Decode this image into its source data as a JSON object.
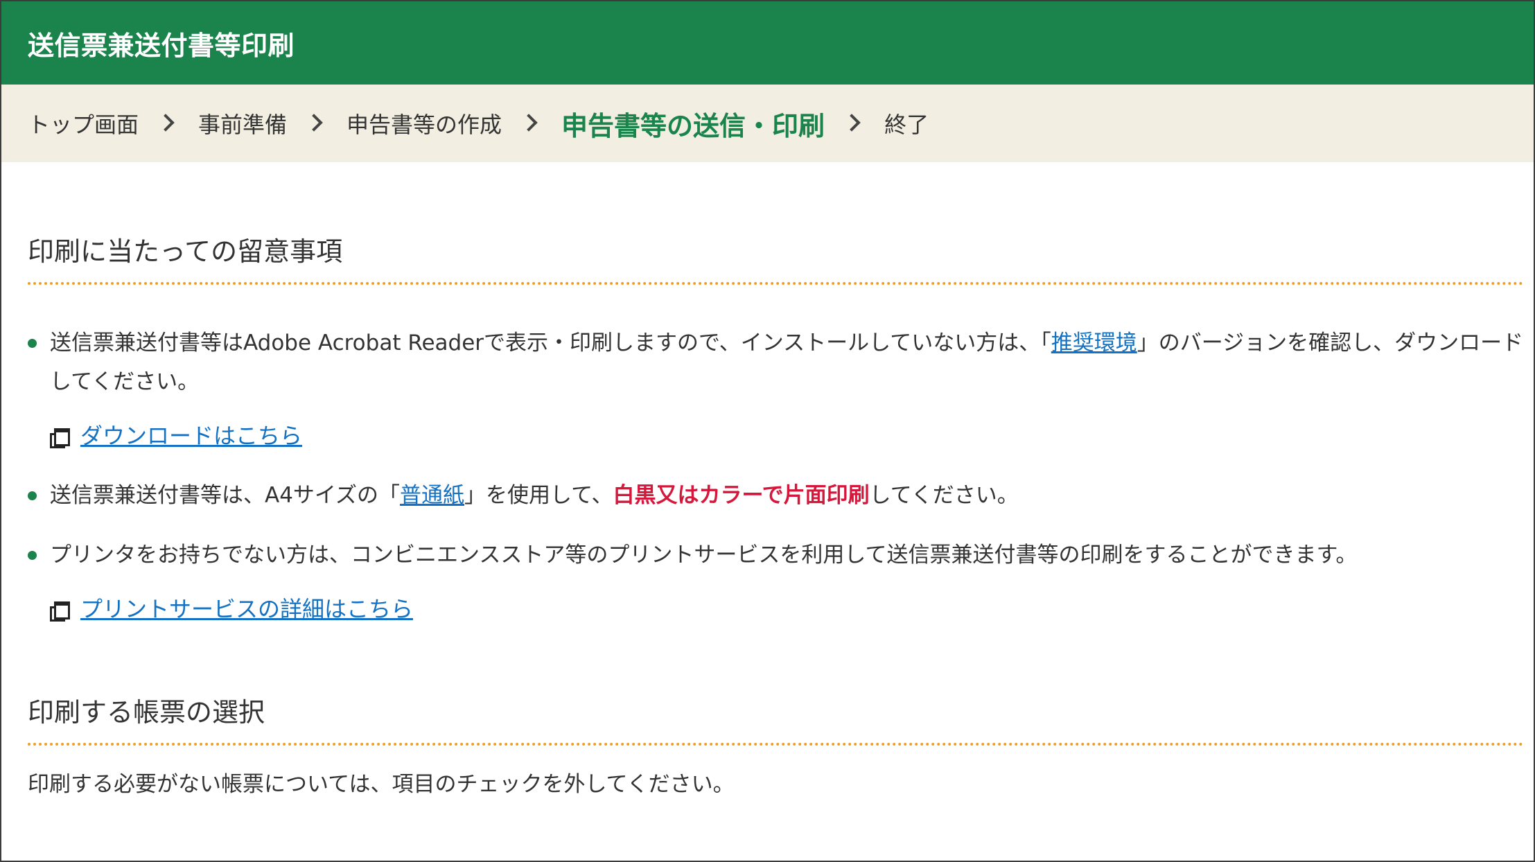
{
  "header": {
    "title": "送信票兼送付書等印刷"
  },
  "breadcrumb": {
    "items": [
      "トップ画面",
      "事前準備",
      "申告書等の作成",
      "申告書等の送信・印刷",
      "終了"
    ],
    "current_index": 3
  },
  "notices_section": {
    "heading": "印刷に当たっての留意事項",
    "items": [
      {
        "text_before": "送信票兼送付書等はAdobe Acrobat Readerで表示・印刷しますので、インストールしていない方は、「",
        "link_label": "推奨環境",
        "text_after": "」のバージョンを確認し、ダウンロードしてください。",
        "sublink_label": "ダウンロードはこちら"
      },
      {
        "text_before": "送信票兼送付書等は、A4サイズの「",
        "link_label": "普通紙",
        "text_middle": "」を使用して、",
        "emphasis": "白黒又はカラーで片面印刷",
        "text_after": "してください。"
      },
      {
        "text": "プリンタをお持ちでない方は、コンビニエンスストア等のプリントサービスを利用して送信票兼送付書等の印刷をすることができます。",
        "sublink_label": "プリントサービスの詳細はこちら"
      }
    ]
  },
  "print_selection_section": {
    "heading": "印刷する帳票の選択",
    "description": "印刷する必要がない帳票については、項目のチェックを外してください。"
  },
  "colors": {
    "header_green": "#1b834c",
    "breadcrumb_bg": "#f2efe2",
    "dotted_rule": "#f0a020",
    "link_blue": "#1372c4",
    "emphasis_red": "#d6173c"
  },
  "icons": {
    "bullet": "green-dot-bullet-icon",
    "external_window": "new-window-icon"
  }
}
